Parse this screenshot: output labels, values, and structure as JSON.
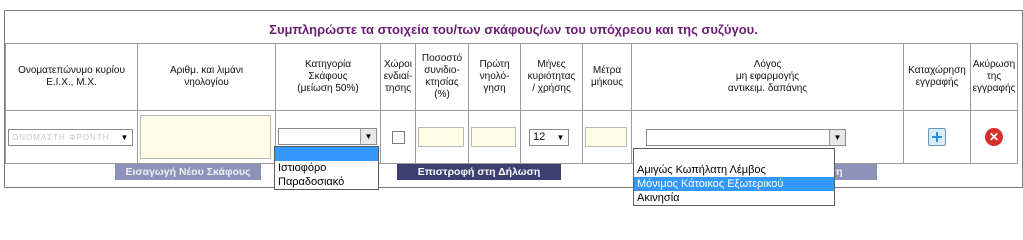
{
  "header": {
    "title": "Συμπληρώστε τα στοιχεία του/των σκάφους/ων του υπόχρεου και της συζύγου."
  },
  "columns": {
    "owner": "Ονοματεπώνυμο κυρίου\nΕ.Ι.Χ., Μ.Χ.",
    "registry": "Αριθμ. και λιμάνι\nνηολογίου",
    "category": "Κατηγορία\nΣκάφους\n(μείωση 50%)",
    "spaces": "Χώροι\nενδιαί-\nτησης",
    "percentage": "Ποσοστό\nσυνιδιο-\nκτησίας\n(%)",
    "first_reg": "Πρώτη\nνηολό-\nγηση",
    "months": "Μήνες\nκυριότητας\n/ χρήσης",
    "length": "Μέτρα\nμήκους",
    "reason": "Λόγος\nμη εφαρμογής\nαντικειμ. δαπάνης",
    "register": "Καταχώρηση\nεγγραφής",
    "cancel": "Ακύρωση\nτης\nεγγραφής"
  },
  "row": {
    "owner_value": "ΟΝΟΜΑΣΤΗ ΦΡΟΝΤΗ",
    "months_value": "12"
  },
  "buttons": {
    "new_vessel": "Εισαγωγή Νέου Σκάφους",
    "back": "Επιστροφή στη Δήλωση",
    "right_partial": "ση"
  },
  "category_dropdown": {
    "options": [
      "",
      "Ιστιοφόρο",
      "Παραδοσιακό"
    ]
  },
  "reason_dropdown": {
    "options": [
      "",
      "Αμιγώς Κωπήλατη Λέμβος",
      "Μόνιμος Κάτοικος Εξωτερικού",
      "Ακινησία"
    ],
    "highlighted_index": 2
  },
  "colors": {
    "title": "#6b1e74",
    "button_bg": "#3d3f73",
    "highlight": "#3399ff",
    "input_bg": "#fffde6"
  }
}
